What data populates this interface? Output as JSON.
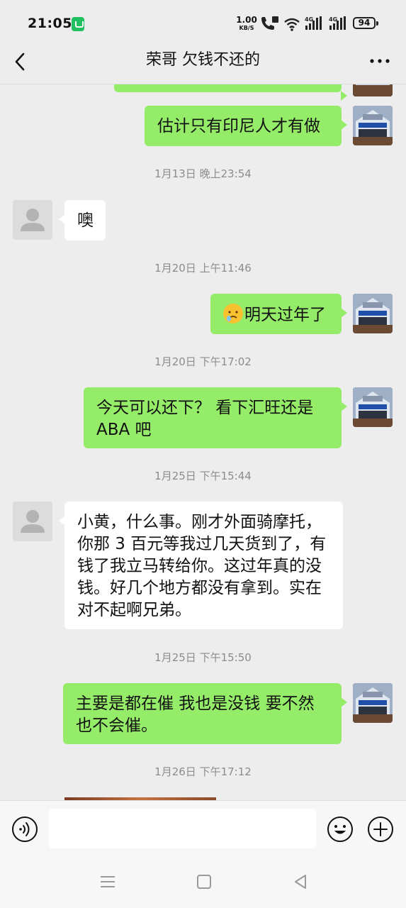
{
  "status_bar": {
    "time": "21:05",
    "net_speed_value": "1.00",
    "net_speed_unit": "KB/S",
    "battery": "94",
    "icons": [
      "wechat-badge-icon",
      "call-hd-icon",
      "wifi-icon",
      "signal-4g-icon",
      "signal-4g-icon",
      "battery-icon"
    ]
  },
  "header": {
    "title": "荣哥 欠钱不还的",
    "back_icon": "chevron-left-icon",
    "more_icon": "more-dots-icon"
  },
  "messages": {
    "m1": "估计只有印尼人才有做",
    "t1": "1月13日 晚上23:54",
    "m2": "噢",
    "t2": "1月20日 上午11:46",
    "m3": "明天过年了",
    "t3": "1月20日 下午17:02",
    "m4": "今天可以还下？  看下汇旺还是ABA 吧",
    "t4": "1月25日 下午15:44",
    "m5": "小黄，什么事。刚才外面骑摩托，你那 3 百元等我过几天货到了，有钱了我立马转给你。这过年真的没钱。好几个地方都没有拿到。实在对不起啊兄弟。",
    "t5": "1月25日 下午15:50",
    "m6": "主要是都在催  我也是没钱  要不然也不会催。",
    "t6": "1月26日 下午17:12"
  },
  "input": {
    "placeholder": "",
    "voice_icon": "voice-icon",
    "emoji_icon": "emoji-icon",
    "plus_icon": "plus-icon"
  },
  "colors": {
    "background": "#ededed",
    "my_bubble": "#95ec69",
    "their_bubble": "#ffffff",
    "timestamp": "#8c8c8c"
  }
}
